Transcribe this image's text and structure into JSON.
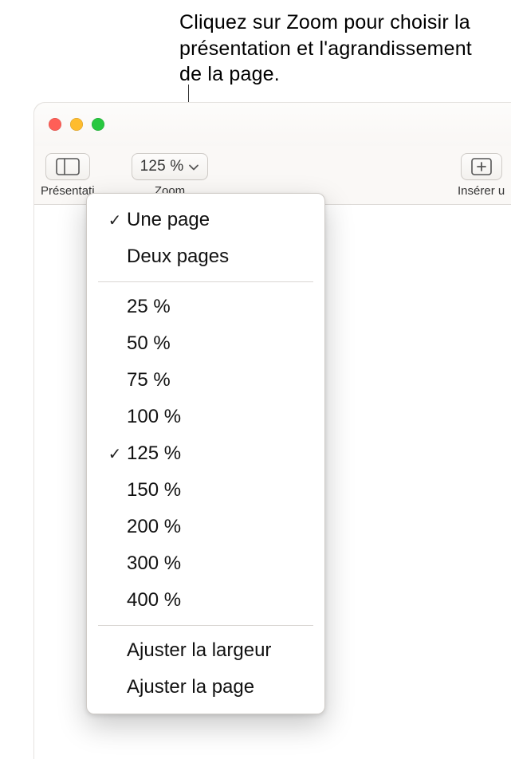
{
  "callout": {
    "text": "Cliquez sur Zoom pour choisir la présentation et l'agrandissement de la page."
  },
  "window": {
    "traffic": {
      "close": "close",
      "minimize": "minimize",
      "maximize": "maximize"
    }
  },
  "toolbar": {
    "presentation": {
      "label": "Présentation"
    },
    "zoom": {
      "value": "125 %",
      "label": "Zoom"
    },
    "insert": {
      "label": "Insérer un"
    }
  },
  "menu": {
    "pageLayout": [
      {
        "label": "Une page",
        "checked": true
      },
      {
        "label": "Deux pages",
        "checked": false
      }
    ],
    "zoomLevels": [
      {
        "label": "25 %",
        "checked": false
      },
      {
        "label": "50 %",
        "checked": false
      },
      {
        "label": "75 %",
        "checked": false
      },
      {
        "label": "100 %",
        "checked": false
      },
      {
        "label": "125 %",
        "checked": true
      },
      {
        "label": "150 %",
        "checked": false
      },
      {
        "label": "200 %",
        "checked": false
      },
      {
        "label": "300 %",
        "checked": false
      },
      {
        "label": "400 %",
        "checked": false
      }
    ],
    "fit": [
      {
        "label": "Ajuster la largeur",
        "checked": false
      },
      {
        "label": "Ajuster la page",
        "checked": false
      }
    ]
  }
}
